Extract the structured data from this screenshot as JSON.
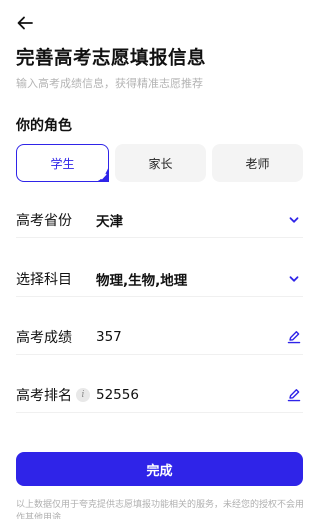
{
  "header": {
    "title": "完善高考志愿填报信息",
    "subtitle": "输入高考成绩信息，获得精准志愿推荐"
  },
  "role_section": {
    "label": "你的角色",
    "options": [
      {
        "label": "学生",
        "selected": true
      },
      {
        "label": "家长",
        "selected": false
      },
      {
        "label": "老师",
        "selected": false
      }
    ]
  },
  "form": {
    "province": {
      "label": "高考省份",
      "value": "天津",
      "action_icon": "chevron-down-icon"
    },
    "subjects": {
      "label": "选择科目",
      "value": "物理,生物,地理",
      "action_icon": "chevron-down-icon"
    },
    "score": {
      "label": "高考成绩",
      "value": "357",
      "action_icon": "edit-pencil-icon"
    },
    "rank": {
      "label": "高考排名",
      "info_icon": "i",
      "value": "52556",
      "action_icon": "edit-pencil-icon"
    }
  },
  "submit_label": "完成",
  "footer_note": "以上数据仅用于夸克提供志愿填报功能相关的服务，未经您的授权不会用作其他用途",
  "colors": {
    "accent": "#2f24e8",
    "muted_text": "#b4b4b4",
    "chip_bg": "#f4f4f4"
  }
}
